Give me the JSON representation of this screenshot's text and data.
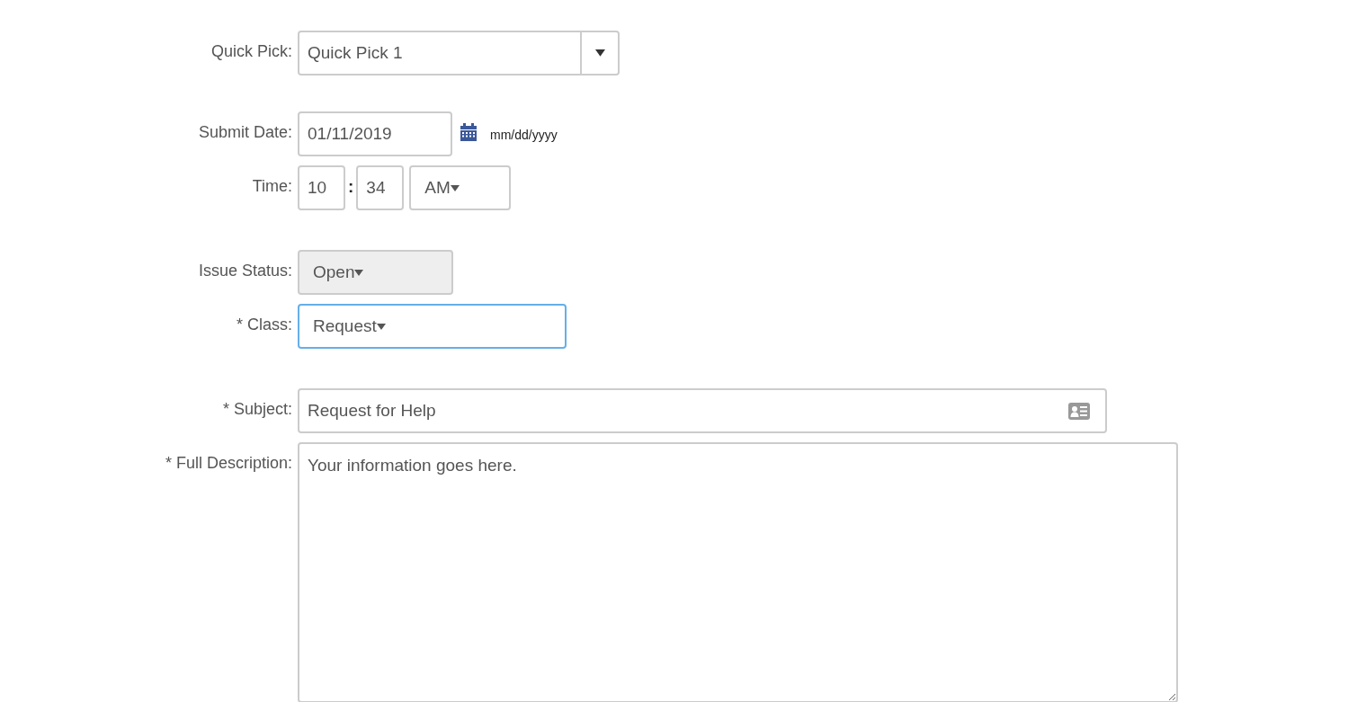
{
  "fields": [
    {
      "kind": "combo",
      "label": "Quick Pick:",
      "value": "Quick Pick 1"
    },
    {
      "kind": "date",
      "label": "Submit Date:",
      "value": "01/11/2019",
      "format_hint": "mm/dd/yyyy"
    },
    {
      "kind": "time",
      "label": "Time:",
      "hour": "10",
      "separator": ":",
      "minute": "34",
      "period": "AM"
    },
    {
      "kind": "select",
      "label": "Issue Status:",
      "value": "Open",
      "disabled": true,
      "focused": false
    },
    {
      "kind": "select",
      "label": "* Class:",
      "value": "Request",
      "disabled": false,
      "focused": true
    },
    {
      "kind": "text",
      "label": "* Subject:",
      "value": "Request for Help"
    },
    {
      "kind": "textarea",
      "label": "* Full Description:",
      "value": "Your information goes here."
    }
  ]
}
